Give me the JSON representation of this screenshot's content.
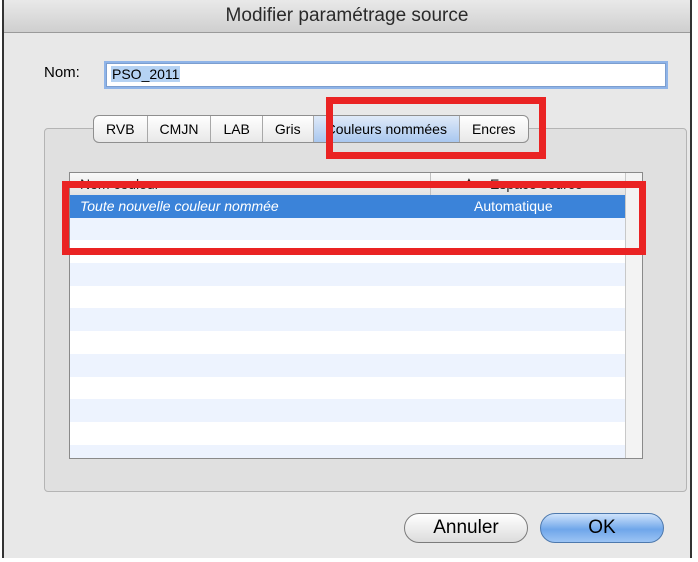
{
  "window": {
    "title": "Modifier paramétrage source"
  },
  "name_field": {
    "label": "Nom:",
    "value": "PSO_2011"
  },
  "tabs": [
    {
      "label": "RVB"
    },
    {
      "label": "CMJN"
    },
    {
      "label": "LAB"
    },
    {
      "label": "Gris"
    },
    {
      "label": "Couleurs nommées"
    },
    {
      "label": "Encres"
    }
  ],
  "selected_tab": "Couleurs nommées",
  "table": {
    "columns": [
      "Nom couleur",
      "Espace source"
    ],
    "rows": [
      {
        "name": "Toute nouvelle couleur nommée",
        "space": "Automatique"
      }
    ]
  },
  "buttons": {
    "cancel": "Annuler",
    "ok": "OK"
  },
  "colors": {
    "highlight": "#ea2323",
    "selection": "#3b83d9",
    "accent_button": "#6fa6ea"
  }
}
